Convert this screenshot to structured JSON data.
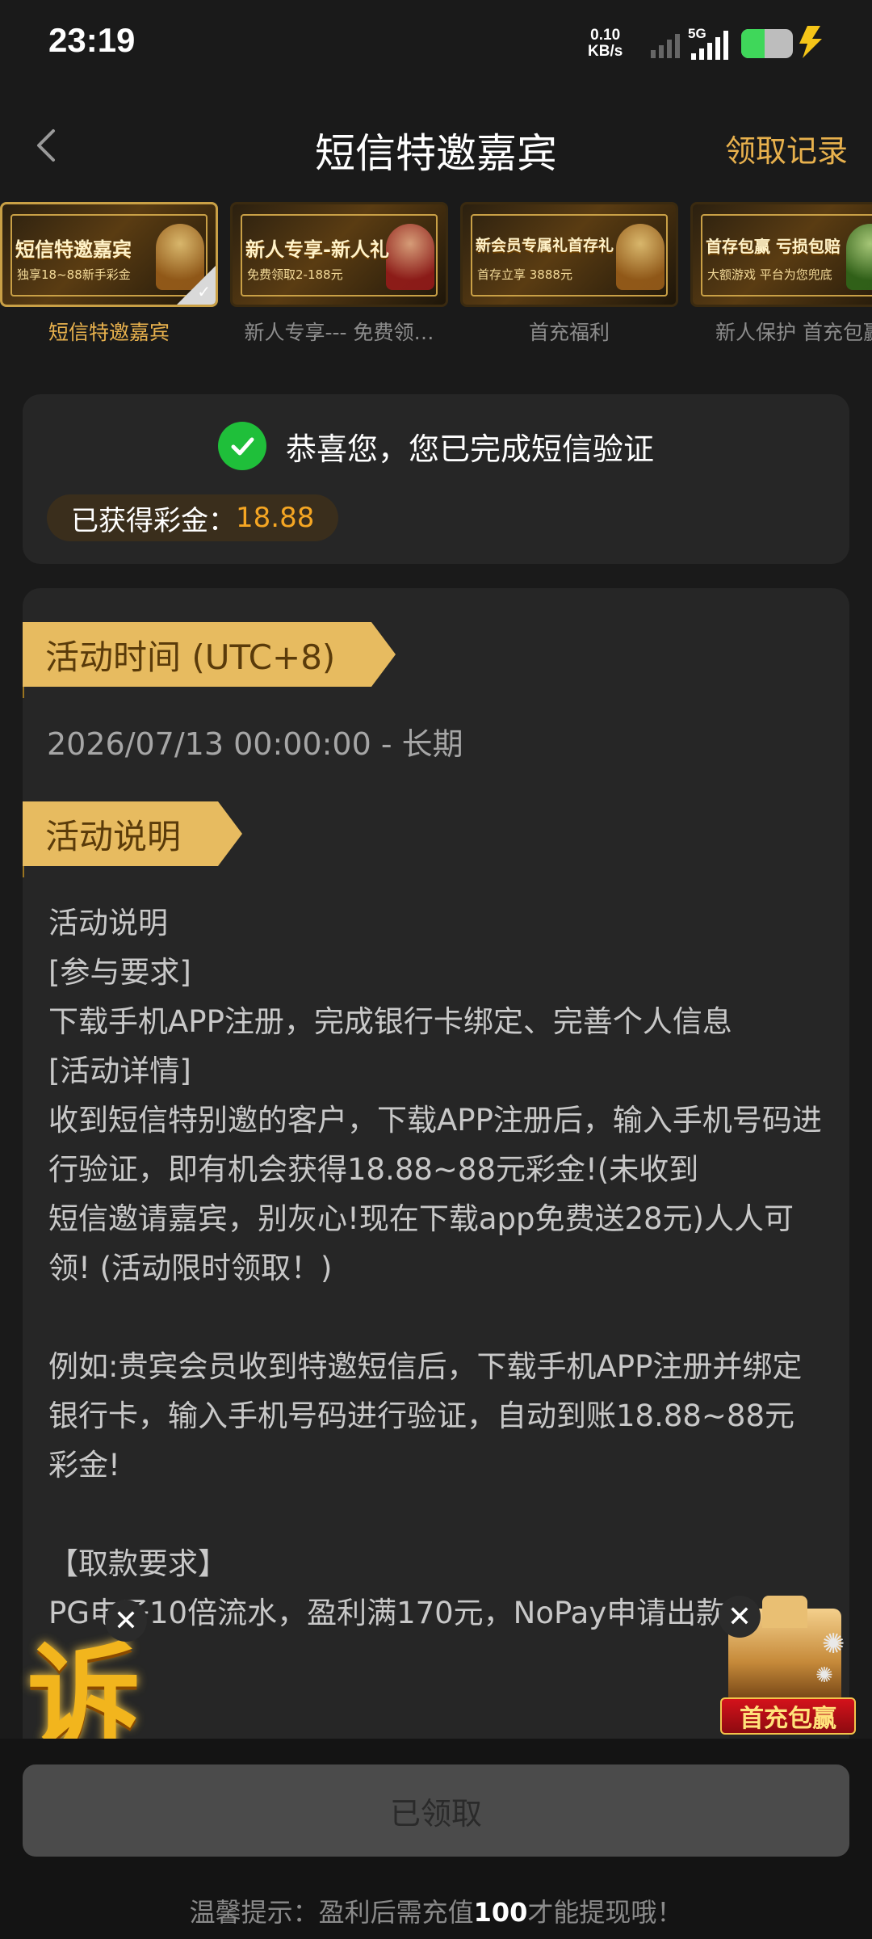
{
  "status_bar": {
    "time": "23:19",
    "net_speed_value": "0.10",
    "net_speed_unit": "KB/s",
    "network_type": "5G",
    "battery_level": 0.45
  },
  "header": {
    "title": "短信特邀嘉宾",
    "records_link": "领取记录"
  },
  "tabs": [
    {
      "label": "短信特邀嘉宾",
      "banner_title": "短信特邀嘉宾",
      "banner_sub": "独享18~88新手彩金",
      "active": true
    },
    {
      "label": "新人专享--- 免费领…",
      "banner_title": "新人专享-新人礼",
      "banner_sub": "免费领取2-188元",
      "active": false
    },
    {
      "label": "首充福利",
      "banner_title": "新会员专属礼首存礼",
      "banner_sub": "首存立享 3888元",
      "active": false
    },
    {
      "label": "新人保护 首充包赢",
      "banner_title": "首存包赢 亏损包赔",
      "banner_sub": "大额游戏 平台为您兜底",
      "active": false
    }
  ],
  "verify": {
    "message": "恭喜您，您已完成短信验证",
    "bonus_label": "已获得彩金：",
    "bonus_value": "18.88"
  },
  "activity": {
    "time_heading": "活动时间 (UTC+8)",
    "time_range": "2026/07/13 00:00:00 - 长期",
    "desc_heading": "活动说明",
    "desc_lines": [
      "活动说明",
      "[参与要求]",
      "下载手机APP注册，完成银行卡绑定、完善个人信息",
      "[活动详情]",
      "收到短信特别邀的客户，下载APP注册后，输入手机号码进行验证，即有机会获得18.88~88元彩金!(未收到",
      "短信邀请嘉宾，别灰心!现在下载app免费送28元)人人可领! (活动限时领取！)",
      "",
      "例如:贵宾会员收到特邀短信后，下载手机APP注册并绑定银行卡，输入手机号码进行验证，自动到账18.88~88元彩金!",
      "",
      "【取款要求】",
      "PG电子10倍流水，盈利满170元，NoPay申请出款"
    ]
  },
  "floats": {
    "left_glyph": "诉",
    "close_symbol": "✕",
    "right_banner": "首充包赢"
  },
  "bottom": {
    "claimed_button": "已领取",
    "tip_prefix": "温馨提示：盈利后需充值",
    "tip_number": "100",
    "tip_suffix": "才能提现哦！"
  }
}
